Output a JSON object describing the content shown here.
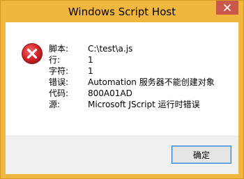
{
  "window": {
    "title": "Windows Script Host"
  },
  "error": {
    "rows": [
      {
        "label": "脚本:",
        "value": "C:\\test\\a.js"
      },
      {
        "label": "行:",
        "value": "1"
      },
      {
        "label": "字符:",
        "value": "1"
      },
      {
        "label": "错误:",
        "value": "Automation 服务器不能创建对象"
      },
      {
        "label": "代码:",
        "value": "800A01AD"
      },
      {
        "label": "源:",
        "value": "Microsoft JScript 运行时错误"
      }
    ]
  },
  "buttons": {
    "ok_label": "确定"
  },
  "icons": {
    "close": "close-icon",
    "error": "error-icon"
  },
  "colors": {
    "title_bar": "#f1b63f",
    "close_button": "#c9584a",
    "error_red": "#d6262a",
    "button_border": "#2f7fd3"
  }
}
